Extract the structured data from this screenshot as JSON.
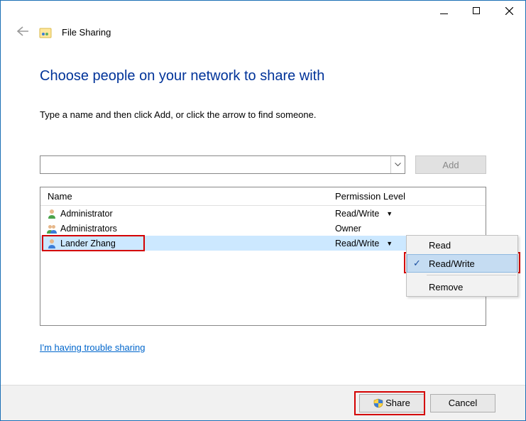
{
  "header": {
    "title": "File Sharing"
  },
  "body": {
    "heading": "Choose people on your network to share with",
    "instruction": "Type a name and then click Add, or click the arrow to find someone.",
    "name_input_value": "",
    "add_label": "Add",
    "columns": {
      "name": "Name",
      "perm": "Permission Level"
    },
    "rows": [
      {
        "name": "Administrator",
        "perm": "Read/Write",
        "arrow": true,
        "selected": false,
        "icon": "user-single"
      },
      {
        "name": "Administrators",
        "perm": "Owner",
        "arrow": false,
        "selected": false,
        "icon": "user-group"
      },
      {
        "name": "Lander Zhang",
        "perm": "Read/Write",
        "arrow": true,
        "selected": true,
        "icon": "user-single"
      }
    ],
    "perm_menu": {
      "items": [
        {
          "label": "Read",
          "checked": false,
          "selected": false
        },
        {
          "label": "Read/Write",
          "checked": true,
          "selected": true
        }
      ],
      "remove_label": "Remove"
    },
    "trouble_link": "I'm having trouble sharing"
  },
  "footer": {
    "share_label": "Share",
    "cancel_label": "Cancel"
  }
}
